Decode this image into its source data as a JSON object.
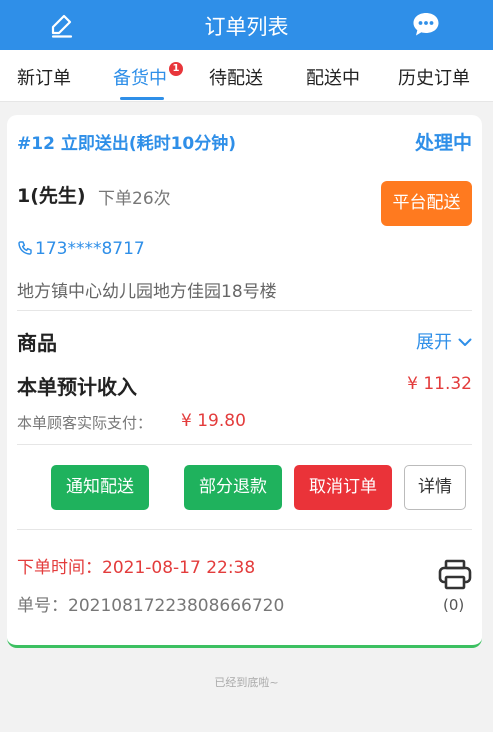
{
  "header": {
    "title": "订单列表",
    "left_icon": "edit-icon",
    "right_icon": "chat-icon",
    "color": "#2f8fe8"
  },
  "tabs": [
    {
      "label": "新订单"
    },
    {
      "label": "备货中",
      "badge": "1",
      "active": true
    },
    {
      "label": "待配送"
    },
    {
      "label": "配送中"
    },
    {
      "label": "历史订单"
    }
  ],
  "order": {
    "header": "#12  立即送出(耗时10分钟)",
    "status": "处理中",
    "customer_name": "1(先生)",
    "customer_count": "下单26次",
    "platform_button": "平台配送",
    "phone": "173****8717",
    "address": "地方镇中心幼儿园地方佳园18号楼",
    "goods_label": "商品",
    "expand_label": "展开",
    "income_label": "本单预计收入",
    "income_value": "¥ 11.32",
    "paid_label": "本单顾客实际支付：",
    "paid_value": "¥ 19.80",
    "actions": {
      "notify": "通知配送",
      "refund": "部分退款",
      "cancel": "取消订单",
      "detail": "详情"
    },
    "time_text": "下单时间：2021-08-17 22:38",
    "order_no_text": "单号：20210817223808666720",
    "print_count": "(0)"
  },
  "footer": "已经到底啦~",
  "colors": {
    "accent": "#2f8fe8",
    "orange": "#ff7a1f",
    "green": "#1fb25d",
    "red": "#ea3339",
    "price": "#e33c3c"
  }
}
